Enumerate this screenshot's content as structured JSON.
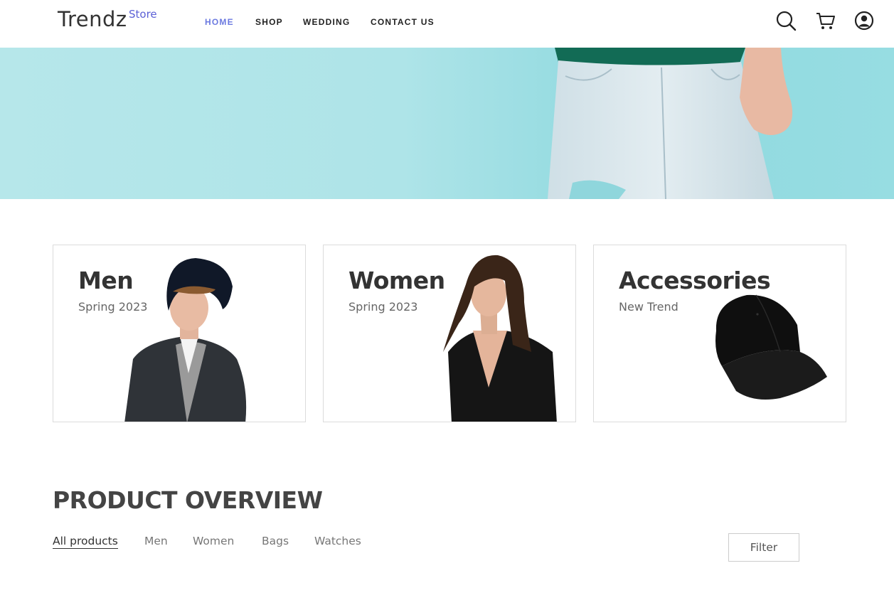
{
  "header": {
    "logo": "Trendz",
    "logo_sup": "Store",
    "nav": [
      "HOME",
      "SHOP",
      "WEDDING",
      "CONTACT US"
    ],
    "active_nav": "HOME",
    "icons": [
      "search-icon",
      "cart-icon",
      "user-account-icon"
    ]
  },
  "categories": [
    {
      "title": "Men",
      "subtitle": "Spring 2023"
    },
    {
      "title": "Women",
      "subtitle": "Spring 2023"
    },
    {
      "title": "Accessories",
      "subtitle": "New Trend"
    }
  ],
  "product_overview": {
    "title": "PRODUCT OVERVIEW",
    "tabs": [
      "All products",
      "Men",
      "Women",
      "Bags",
      "Watches"
    ],
    "active_tab": "All products",
    "filter_label": "Filter"
  },
  "colors": {
    "accent": "#6c7ae0",
    "logo_sup": "#5b60d6",
    "hero_bg": "#aee4e8"
  }
}
